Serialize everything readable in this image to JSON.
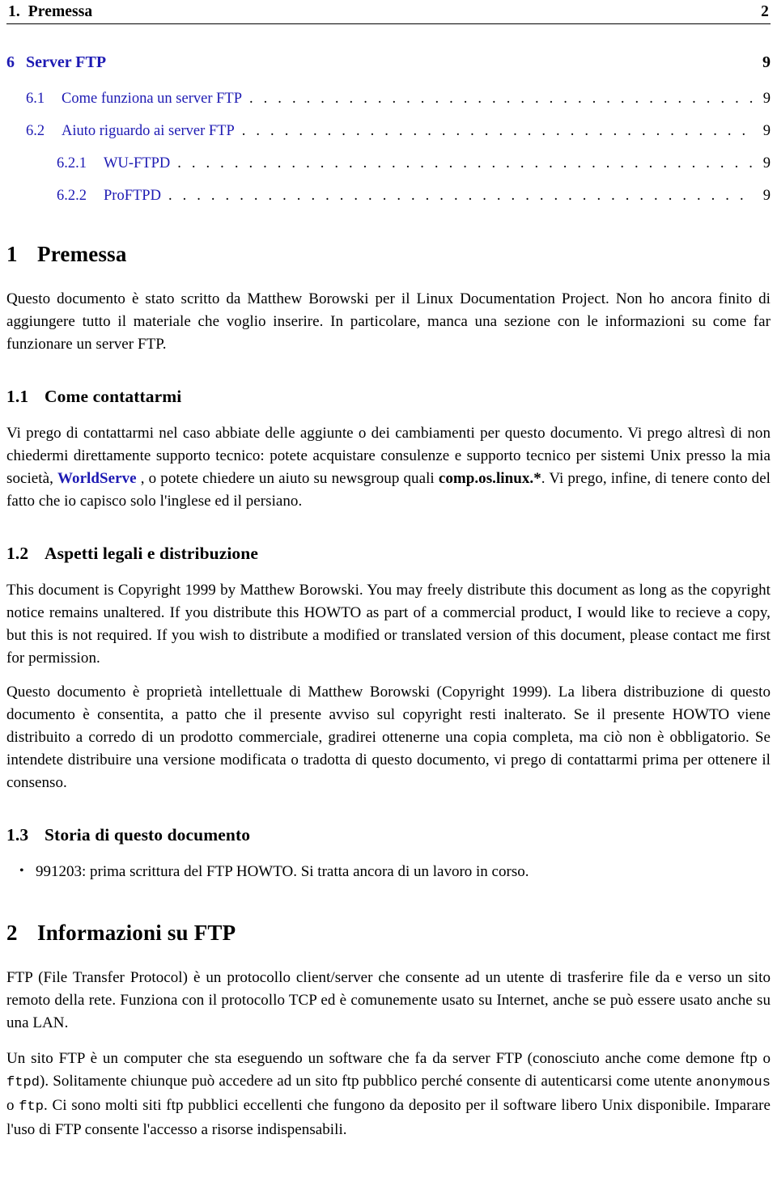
{
  "running_header": {
    "left": "1.  Premessa",
    "page": "2"
  },
  "colors": {
    "link_blue": "#1d1ab3",
    "text_black": "#000000",
    "page_background": "#ffffff"
  },
  "toc": {
    "entries": [
      {
        "level": 0,
        "number": "6",
        "title": "Server FTP",
        "dots": "",
        "page": "9"
      },
      {
        "level": 1,
        "number": "6.1",
        "title": "Come funziona un server FTP",
        "dots": ". . . . . . . . . . . . . . . . . . . . . . . . . . . . . . . . . . . . . . . . . . . . . . . . . . . . . . . . . . . . . .",
        "page": "9"
      },
      {
        "level": 1,
        "number": "6.2",
        "title": "Aiuto riguardo ai server FTP",
        "dots": ". . . . . . . . . . . . . . . . . . . . . . . . . . . . . . . . . . . . . . . . . . . . . . . . . . . . . . . . . . . . . .",
        "page": "9"
      },
      {
        "level": 2,
        "number": "6.2.1",
        "title": "WU-FTPD",
        "dots": ". . . . . . . . . . . . . . . . . . . . . . . . . . . . . . . . . . . . . . . . . . . . . . . . . . . . . . . . . . . . . .",
        "page": "9"
      },
      {
        "level": 2,
        "number": "6.2.2",
        "title": "ProFTPD",
        "dots": ". . . . . . . . . . . . . . . . . . . . . . . . . . . . . . . . . . . . . . . . . . . . . . . . . . . . . . . . . . . . . .",
        "page": "9"
      }
    ]
  },
  "sections": {
    "premessa": {
      "number": "1",
      "title": "Premessa",
      "intro": "Questo documento è stato scritto da Matthew Borowski per il Linux Documentation Project. Non ho ancora finito di aggiungere tutto il materiale che voglio inserire. In particolare, manca una sezione con le informazioni su come far funzionare un server FTP."
    },
    "come_contattarmi": {
      "number": "1.1",
      "title": "Come contattarmi",
      "para_part1": "Vi prego di contattarmi nel caso abbiate delle aggiunte o dei cambiamenti per questo documento. Vi prego altresì di non chiedermi direttamente supporto tecnico: potete acquistare consulenze e supporto tecnico per sistemi Unix presso la mia società, ",
      "link_label": "WorldServe",
      "para_part2": " , o potete chiedere un aiuto su newsgroup quali ",
      "newsgroup": "comp.os.linux.*",
      "para_part3": ". Vi prego, infine, di tenere conto del fatto che io capisco solo l'inglese ed il persiano."
    },
    "aspetti_legali": {
      "number": "1.2",
      "title": "Aspetti legali e distribuzione",
      "para_en": "This document is Copyright 1999 by Matthew Borowski. You may freely distribute this document as long as the copyright notice remains unaltered. If you distribute this HOWTO as part of a commercial product, I would like to recieve a copy, but this is not required. If you wish to distribute a modified or translated version of this document, please contact me first for permission.",
      "para_it": "Questo documento è proprietà intellettuale di Matthew Borowski (Copyright 1999). La libera distribuzione di questo documento è consentita, a patto che il presente avviso sul copyright resti inalterato. Se il presente HOWTO viene distribuito a corredo di un prodotto commerciale, gradirei ottenerne una copia completa, ma ciò non è obbligatorio. Se intendete distribuire una versione modificata o tradotta di questo documento, vi prego di contattarmi prima per ottenere il consenso."
    },
    "storia": {
      "number": "1.3",
      "title": "Storia di questo documento",
      "items": [
        "991203: prima scrittura del FTP HOWTO. Si tratta ancora di un lavoro in corso."
      ]
    },
    "informazioni": {
      "number": "2",
      "title": "Informazioni su FTP",
      "para1": "FTP (File Transfer Protocol) è un protocollo client/server che consente ad un utente di trasferire file da e verso un sito remoto della rete. Funziona con il protocollo TCP ed è comunemente usato su Internet, anche se può essere usato anche su una LAN.",
      "para2_part1": "Un sito FTP è un computer che sta eseguendo un software che fa da server FTP (conosciuto anche come demone ftp o ",
      "code_ftpd": "ftpd",
      "para2_part2": "). Solitamente chiunque può accedere ad un sito ftp pubblico perché consente di autenticarsi come utente ",
      "code_anonymous": "anonymous",
      "para2_part3": " o ",
      "code_ftp": "ftp",
      "para2_part4": ". Ci sono molti siti ftp pubblici eccellenti che fungono da deposito per il software libero Unix disponibile. Imparare l'uso di FTP consente l'accesso a risorse indispensabili."
    }
  }
}
